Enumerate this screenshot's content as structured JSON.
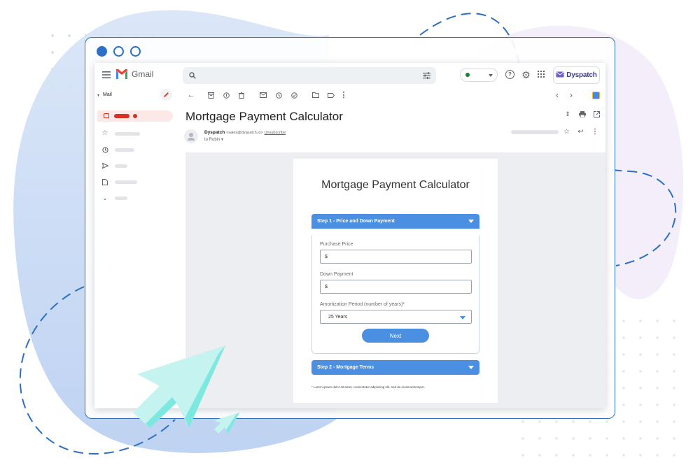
{
  "window": {
    "controls": [
      "close",
      "minimize",
      "maximize"
    ]
  },
  "gmail": {
    "product_name": "Gmail",
    "sidebar": {
      "folder_label": "Mail"
    },
    "header_addon": {
      "label": "Dyspatch"
    },
    "icons": {
      "menu": "hamburger-icon",
      "search": "search-icon",
      "filter": "filter-sliders-icon",
      "help": "help-icon",
      "settings": "gear-icon",
      "apps": "apps-grid-icon",
      "compose": "pencil-icon",
      "back": "arrow-left-icon",
      "archive": "archive-icon",
      "spam": "report-icon",
      "delete": "trash-icon",
      "unread": "envelope-icon",
      "snooze": "clock-icon",
      "task": "add-task-icon",
      "move": "folder-icon",
      "label": "label-icon",
      "more": "more-vert-icon"
    },
    "email": {
      "subject": "Mortgage Payment Calculator",
      "sender_name": "Dyspatch",
      "sender_email": "<sales@dyspatch.io>",
      "unsubscribe": "Unsubscribe",
      "to": "to Robin"
    }
  },
  "calculator": {
    "title": "Mortgage Payment Calculator",
    "step1": {
      "label": "Step 1 - Price and Down Payment",
      "fields": [
        {
          "label": "Purchase Price",
          "value": "$"
        },
        {
          "label": "Down Payment",
          "value": "$"
        }
      ],
      "select": {
        "label": "Amortization Period (number of years)*",
        "value": "25 Years"
      },
      "next_label": "Next"
    },
    "step2": {
      "label": "Step 2 - Mortgage Terms"
    },
    "footnote": "* Lorem ipsum dolor sit amet, consectetur adipiscing elit, sed do eiusmod tempor."
  },
  "colors": {
    "brand_blue": "#2d6fc4",
    "button_blue": "#4a8fe2",
    "gmail_red": "#ea4335",
    "status_green": "#188038",
    "decor_cursor": "#7de8e0"
  }
}
